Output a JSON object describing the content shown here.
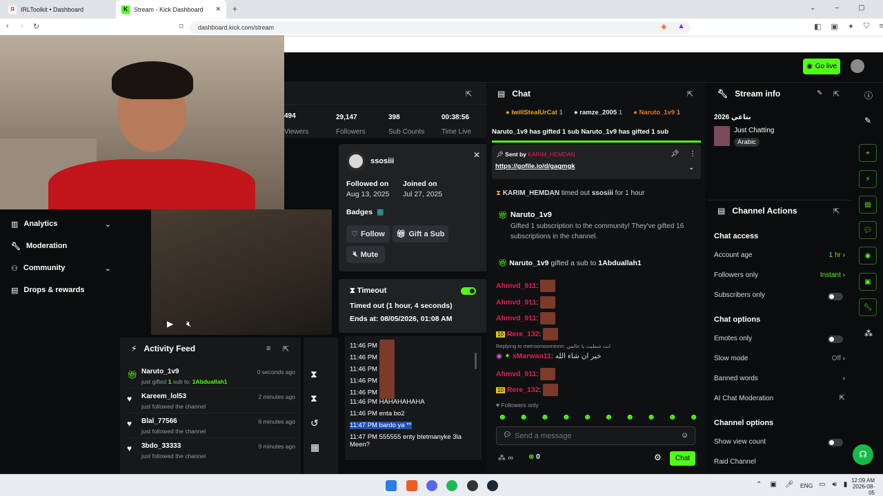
{
  "browser": {
    "tabs": [
      {
        "label": "IRLToolkit • Dashboard"
      },
      {
        "label": "Stream - Kick Dashboard"
      }
    ],
    "url": "dashboard.kick.com/stream"
  },
  "header": {
    "go_live": "Go live"
  },
  "stats": [
    {
      "value": "494",
      "label": "Viewers"
    },
    {
      "value": "29,147",
      "label": "Followers"
    },
    {
      "value": "398",
      "label": "Sub Counts"
    },
    {
      "value": "00:38:56",
      "label": "Time Live"
    }
  ],
  "sidebar": {
    "items": [
      {
        "label": "Analytics"
      },
      {
        "label": "Moderation"
      },
      {
        "label": "Community"
      },
      {
        "label": "Drops & rewards"
      }
    ]
  },
  "activity": {
    "title": "Activity Feed",
    "items": [
      {
        "user": "Naruto_1v9",
        "text": "just gifted",
        "count": "1",
        "mid": "sub to:",
        "target": "1Abduallah1",
        "time": "0 seconds ago"
      },
      {
        "user": "Kareem_lol53",
        "text": "just followed the channel",
        "time": "2 minutes ago"
      },
      {
        "user": "Blal_77566",
        "text": "just followed the channel",
        "time": "6 minutes ago"
      },
      {
        "user": "3bdo_33333",
        "text": "just followed the channel",
        "time": "9 minutes ago"
      }
    ]
  },
  "user_popup": {
    "username": "ssosiii",
    "followed_label": "Followed on",
    "followed_date": "Aug 13, 2025",
    "joined_label": "Joined on",
    "joined_date": "Jul 27, 2025",
    "badges_label": "Badges",
    "follow": "Follow",
    "gift": "Gift a Sub",
    "mute": "Mute"
  },
  "timeout": {
    "title": "Timeout",
    "status": "Timed out (1 hour, 4 seconds)",
    "ends": "Ends at: 08/05/2026, 01:08 AM"
  },
  "user_messages": [
    {
      "time": "11:46 PM",
      "text": ""
    },
    {
      "time": "11:46 PM",
      "text": ""
    },
    {
      "time": "11:46 PM",
      "text": ""
    },
    {
      "time": "11:46 PM",
      "text": ""
    },
    {
      "time": "11:46 PM",
      "text": ""
    },
    {
      "time": "11:46 PM",
      "text": "HAHAHAHAHA"
    },
    {
      "time": "11:46 PM",
      "text": "enta bo2"
    },
    {
      "time": "11:47 PM",
      "text": "bardo ya **"
    },
    {
      "time": "11:47 PM",
      "text": "555555 enty btetmanyke 3la Meen?"
    }
  ],
  "chat": {
    "title": "Chat",
    "top_gifters": [
      {
        "name": "IwillStealUrCat",
        "n": "1"
      },
      {
        "name": "ramze_2005",
        "n": "1"
      },
      {
        "name": "Naruto_1v9",
        "n": "1"
      }
    ],
    "marquee": "Naruto_1v9 has gifted 1 sub   Naruto_1v9 has gifted 1 sub",
    "pinned_by": "Sent by",
    "pinned_user": "KARIM_HEMDAN",
    "pinned_link": "https://gofile.io/d/gagmgk",
    "timeout_msg_user": "KARIM_HEMDAN",
    "timeout_msg_text": "timed out",
    "timeout_msg_target": "ssosiii",
    "timeout_msg_dur": "for 1 hour",
    "gift_user": "Naruto_1v9",
    "gift_text": "Gifted 1 subscription to the community! They've gifted 16 subscriptions in the channel.",
    "gift2_user": "Naruto_1v9",
    "gift2_text": "gifted a sub to",
    "gift2_target": "1Abduallah1",
    "lines": [
      {
        "user": "Ahmvd_911"
      },
      {
        "user": "Ahmvd_911"
      },
      {
        "user": "Ahmvd_911"
      },
      {
        "user": "Rere_132"
      }
    ],
    "reply_to": "Replying to metroomoominnn: انت شطبت يا عالمي",
    "reply_user": "xMarwan11",
    "reply_text": "خير ان شاء الله",
    "lines2": [
      {
        "user": "Ahmvd_911"
      },
      {
        "user": "Rere_132"
      }
    ],
    "followers_only": "Followers only",
    "placeholder": "Send a message",
    "count": "0",
    "send": "Chat"
  },
  "stream_info": {
    "title": "Stream info",
    "stream_title": "2026 بتاعي",
    "category": "Just Chatting",
    "language": "Arabic"
  },
  "channel_actions": {
    "title": "Channel Actions",
    "chat_access": "Chat access",
    "account_age": "Account age",
    "account_age_val": "1 hr",
    "followers_only": "Followers only",
    "followers_only_val": "Instant",
    "subscribers_only": "Subscribers only",
    "chat_options": "Chat options",
    "emotes_only": "Emotes only",
    "slow_mode": "Slow mode",
    "slow_mode_val": "Off",
    "banned_words": "Banned words",
    "ai_mod": "AI Chat Moderation",
    "channel_options": "Channel options",
    "show_view_count": "Show view count",
    "raid": "Raid Channel"
  },
  "taskbar": {
    "lang": "ENG",
    "time": "12:09 AM",
    "date": "2026-08-05"
  },
  "colors": {
    "accent": "#53fc18",
    "username_red": "#e2204f",
    "gold": "#e0a526"
  }
}
